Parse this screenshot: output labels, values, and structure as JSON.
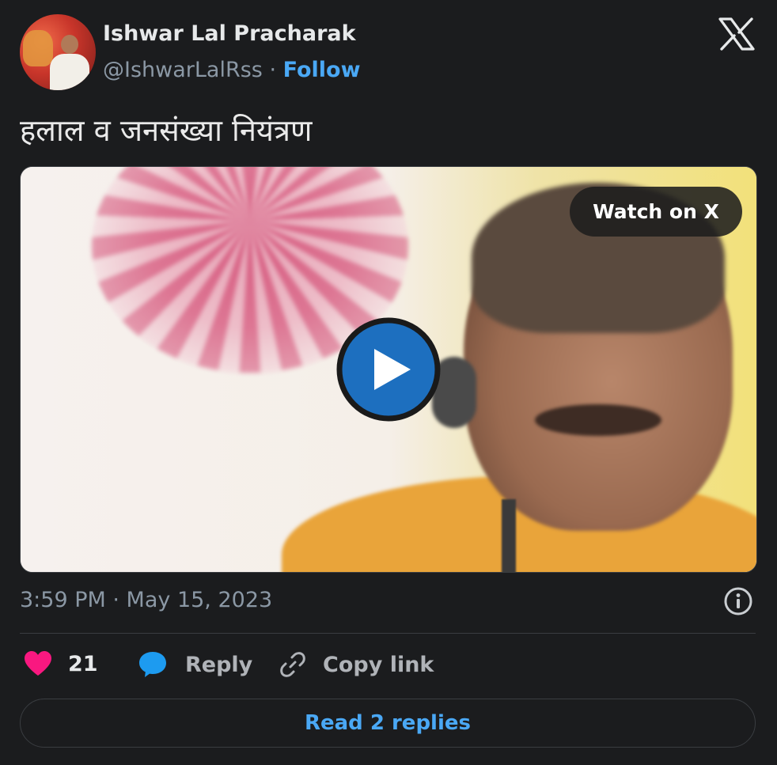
{
  "author": {
    "name": "Ishwar Lal Pracharak",
    "handle": "@IshwarLalRss",
    "separator": "·",
    "follow_label": "Follow"
  },
  "tweet": {
    "text": "हलाल व जनसंख्या नियंत्रण",
    "timestamp": "3:59 PM · May 15, 2023"
  },
  "media": {
    "watch_label": "Watch on X"
  },
  "actions": {
    "likes": "21",
    "reply_label": "Reply",
    "copy_label": "Copy link",
    "read_replies_label": "Read 2 replies"
  },
  "icons": {
    "brand": "x-logo-icon",
    "play": "play-icon",
    "info": "info-icon",
    "like": "heart-icon",
    "reply": "speech-bubble-icon",
    "copy": "link-icon"
  },
  "colors": {
    "background": "#1b1c1e",
    "accent": "#4aa8f5",
    "like": "#f91880",
    "play": "#1d6fbf"
  }
}
